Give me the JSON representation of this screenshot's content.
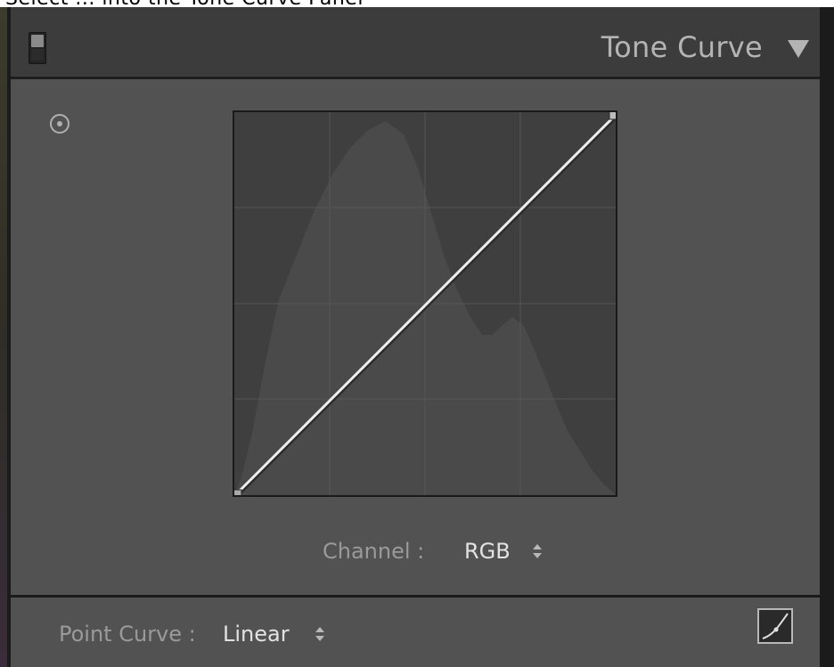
{
  "top_strip_text": "Select ... into the Tone Curve Panel",
  "panel": {
    "title": "Tone Curve"
  },
  "channel": {
    "label": "Channel :",
    "value": "RGB"
  },
  "point_curve": {
    "label": "Point Curve :",
    "value": "Linear"
  },
  "colors": {
    "panel_bg": "#525252",
    "header_bg": "#3c3c3c",
    "curve_bg": "#3f3f3f",
    "histogram": "#4a4a4a",
    "curve_line": "#eeeeee",
    "label_text": "#9a9a9a",
    "value_text": "#e2e2e2"
  },
  "icons": {
    "panel_switch": "panel-switch-icon",
    "collapse": "triangle-down-icon",
    "target": "target-adjustment-icon",
    "spinner": "up-down-arrows-icon",
    "edit_curve": "edit-point-curve-icon"
  }
}
